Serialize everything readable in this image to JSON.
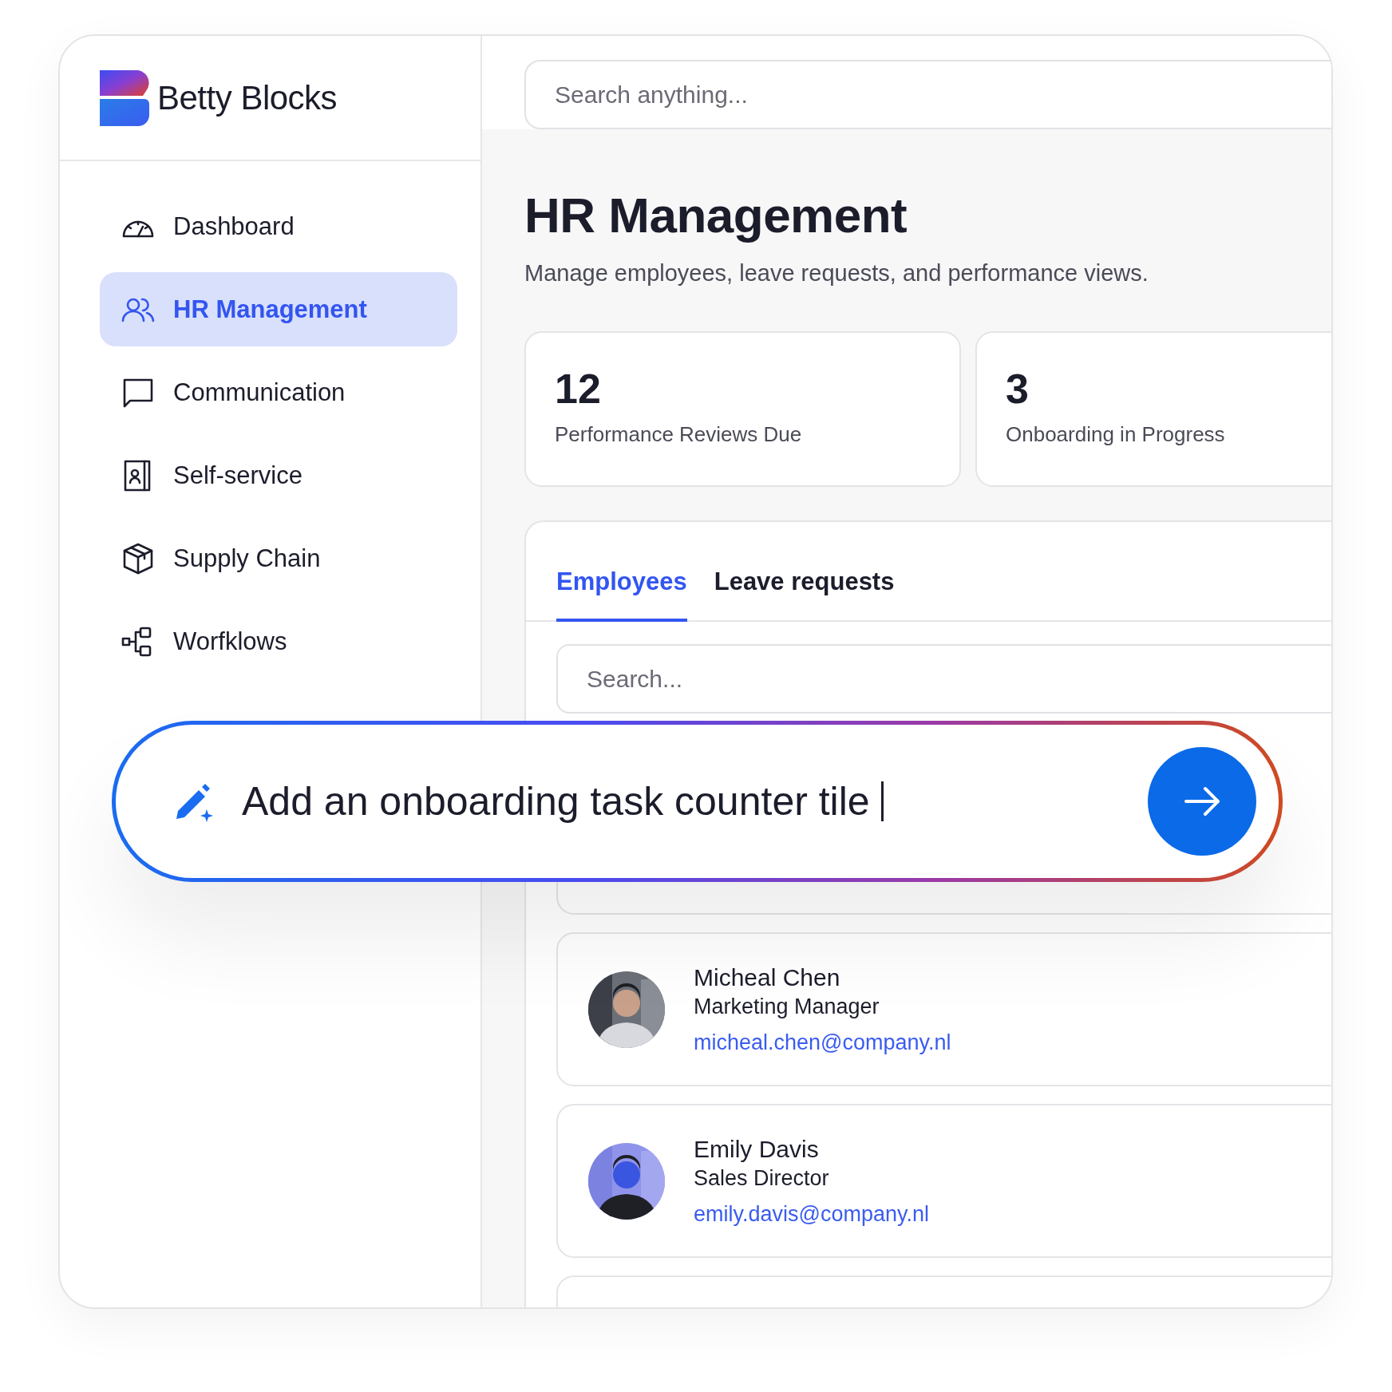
{
  "brand": {
    "name": "Betty Blocks"
  },
  "search": {
    "placeholder": "Search anything..."
  },
  "sidebar": {
    "items": [
      {
        "label": "Dashboard",
        "kind": "gauge",
        "selected": false
      },
      {
        "label": "HR Management",
        "kind": "people",
        "selected": true
      },
      {
        "label": "Communication",
        "kind": "chat",
        "selected": false
      },
      {
        "label": "Self-service",
        "kind": "contact",
        "selected": false
      },
      {
        "label": "Supply Chain",
        "kind": "box",
        "selected": false
      },
      {
        "label": "Worfklows",
        "kind": "flow",
        "selected": false
      }
    ]
  },
  "page": {
    "title": "HR Management",
    "subtitle": "Manage employees, leave requests, and performance views."
  },
  "stats": [
    {
      "value": "12",
      "label": "Performance Reviews Due"
    },
    {
      "value": "3",
      "label": "Onboarding in Progress"
    }
  ],
  "tabs": [
    {
      "label": "Employees",
      "selected": true
    },
    {
      "label": "Leave requests",
      "selected": false
    }
  ],
  "list_search": {
    "placeholder": "Search..."
  },
  "employees": [
    {
      "name": "Micheal Chen",
      "role": "Marketing Manager",
      "email": "micheal.chen@company.nl",
      "kind": "picture"
    },
    {
      "name": "Emily Davis",
      "role": "Sales Director",
      "email": "emily.davis@company.nl",
      "kind": "picture"
    }
  ],
  "prompt": {
    "value": "Add an onboarding task counter tile"
  }
}
